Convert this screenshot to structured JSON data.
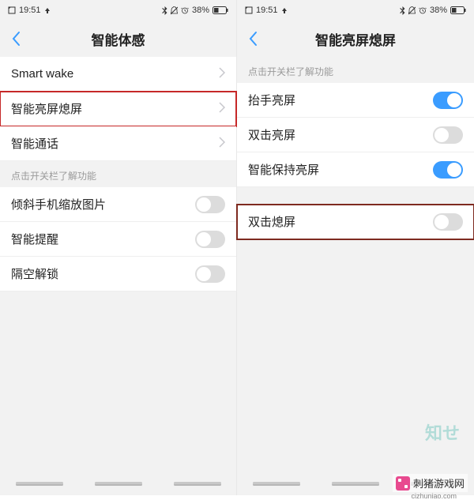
{
  "status": {
    "time": "19:51",
    "battery_pct": "38%"
  },
  "left": {
    "title": "智能体感",
    "rows": {
      "smart_wake": "Smart wake",
      "smart_screen": "智能亮屏熄屏",
      "smart_call": "智能通话"
    },
    "hint": "点击开关栏了解功能",
    "toggles": {
      "tilt_zoom": "倾斜手机缩放图片",
      "smart_remind": "智能提醒",
      "air_unlock": "隔空解锁"
    }
  },
  "right": {
    "title": "智能亮屏熄屏",
    "hint": "点击开关栏了解功能",
    "toggles": {
      "raise_wake": "抬手亮屏",
      "double_tap_wake": "双击亮屏",
      "smart_keep_on": "智能保持亮屏",
      "double_tap_off": "双击熄屏"
    }
  },
  "brand": {
    "name": "刺猪游戏网",
    "domain": "cizhuniao.com"
  }
}
